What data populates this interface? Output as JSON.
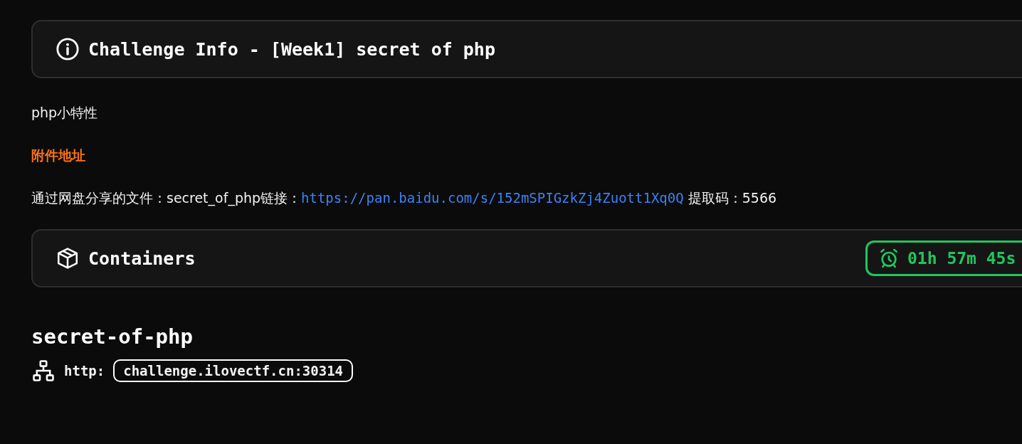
{
  "challenge_info": {
    "title": "Challenge Info - [Week1] secret of php"
  },
  "description": [
    {
      "kind": "text",
      "text": "php小特性"
    },
    {
      "kind": "heading",
      "text": "附件地址"
    },
    {
      "kind": "link_line",
      "before": "通过网盘分享的文件：secret_of_php链接：",
      "link": "https://pan.baidu.com/s/152mSPIGzkZj4Zuott1Xq0Q",
      "after": "提取码：5566"
    }
  ],
  "containers": {
    "title": "Containers",
    "timer": "01h 57m 45s"
  },
  "instance": {
    "name": "secret-of-php",
    "protocol": "http:",
    "address": "challenge.ilovectf.cn:30314"
  }
}
